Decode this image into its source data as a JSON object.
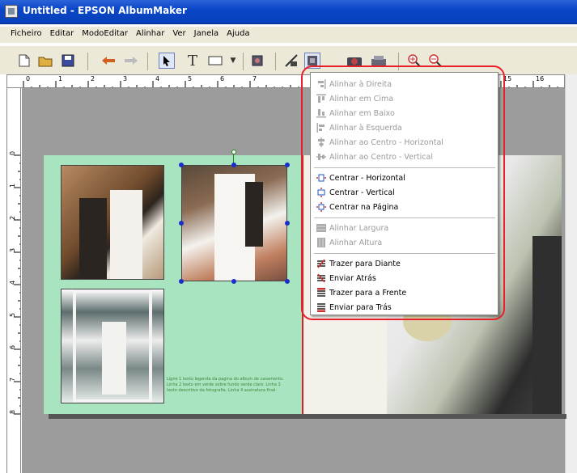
{
  "window": {
    "title": "Untitled - EPSON AlbumMaker"
  },
  "menu": [
    "Ficheiro",
    "Editar",
    "ModoEditar",
    "Alinhar",
    "Ver",
    "Janela",
    "Ajuda"
  ],
  "toolbar_icons": [
    "new-file-icon",
    "open-folder-icon",
    "save-icon",
    "undo-icon",
    "redo-icon",
    "pointer-icon",
    "text-icon",
    "rectangle-icon",
    "dropdown-icon",
    "image-insert-icon",
    "align-icon",
    "align-menu-icon",
    "camera-icon",
    "scanner-icon",
    "zoom-in-icon",
    "zoom-out-icon"
  ],
  "ruler_h": [
    "0",
    "1",
    "2",
    "3",
    "4",
    "5",
    "6",
    "7",
    "15",
    "16"
  ],
  "ruler_v": [
    "0",
    "1",
    "2",
    "3",
    "4",
    "5",
    "6",
    "7",
    "8"
  ],
  "caption_text": "Ligne 1 texto legenda da pagina do album de casamento. Linha 2 texto em verde sobre fundo verde claro. Linha 3 texto descritivo da fotografia. Linha 4 assinatura final.",
  "context_menu": {
    "items": [
      {
        "label": "Alinhar à Direita",
        "enabled": false,
        "icon": "align-right-icon"
      },
      {
        "label": "Alinhar em Cima",
        "enabled": false,
        "icon": "align-top-icon"
      },
      {
        "label": "Alinhar em Baixo",
        "enabled": false,
        "icon": "align-bottom-icon"
      },
      {
        "label": "Alinhar à Esquerda",
        "enabled": false,
        "icon": "align-left-icon"
      },
      {
        "label": "Alinhar ao Centro - Horizontal",
        "enabled": false,
        "icon": "align-center-horizontal-icon"
      },
      {
        "label": "Alinhar ao Centro - Vertical",
        "enabled": false,
        "icon": "align-center-vertical-icon"
      },
      {
        "label": "Centrar - Horizontal",
        "enabled": true,
        "icon": "center-horizontal-icon"
      },
      {
        "label": "Centrar - Vertical",
        "enabled": true,
        "icon": "center-vertical-icon"
      },
      {
        "label": "Centrar na Página",
        "enabled": true,
        "icon": "center-page-icon"
      },
      {
        "label": "Alinhar Largura",
        "enabled": false,
        "icon": "match-width-icon"
      },
      {
        "label": "Alinhar Altura",
        "enabled": false,
        "icon": "match-height-icon"
      },
      {
        "label": "Trazer para Diante",
        "enabled": true,
        "icon": "bring-forward-icon"
      },
      {
        "label": "Enviar Atrás",
        "enabled": true,
        "icon": "send-backward-icon"
      },
      {
        "label": "Trazer para a Frente",
        "enabled": true,
        "icon": "bring-to-front-icon"
      },
      {
        "label": "Enviar para Trás",
        "enabled": true,
        "icon": "send-to-back-icon"
      }
    ]
  },
  "colors": {
    "title_bar": "#0a46c8",
    "menu_bg": "#ece9d8",
    "canvas_bg": "#9c9c9c",
    "page_left": "#a9e4c0",
    "guide_red": "#d82020",
    "handle_blue": "#1b2ecc",
    "highlight_red": "#e8202a"
  }
}
